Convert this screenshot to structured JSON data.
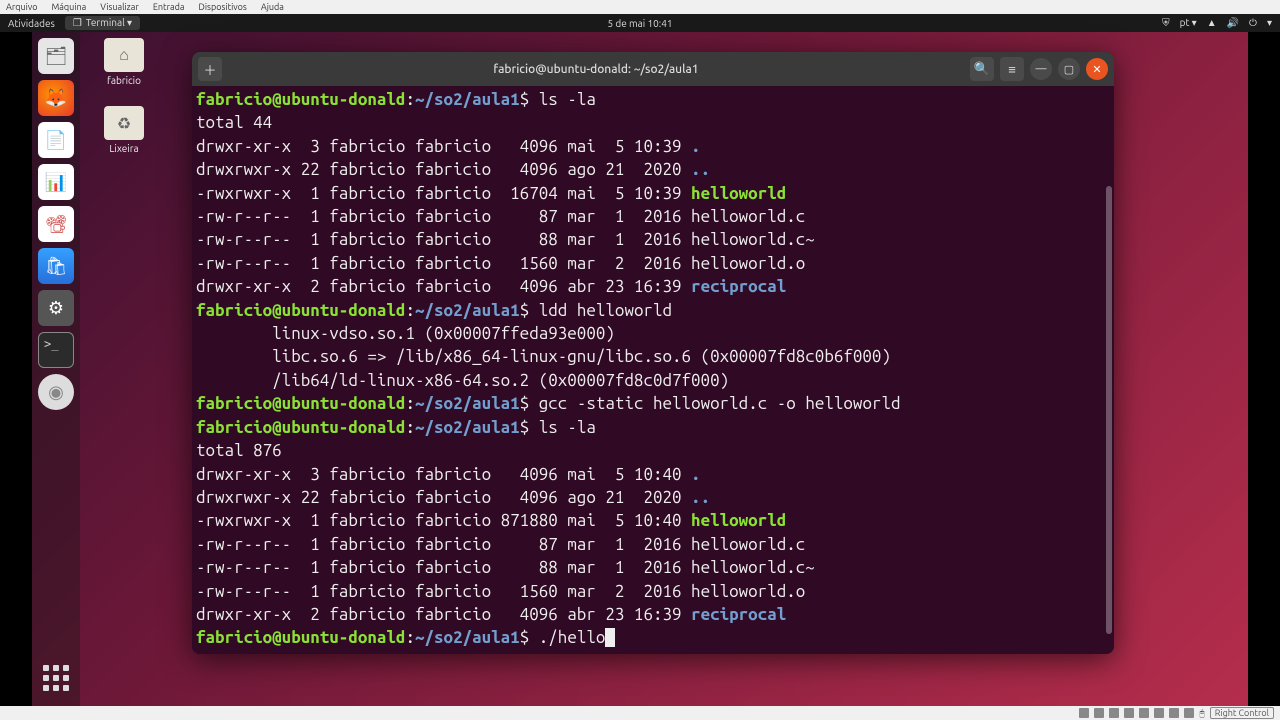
{
  "vbox_menu": [
    "Arquivo",
    "Máquina",
    "Visualizar",
    "Entrada",
    "Dispositivos",
    "Ajuda"
  ],
  "topbar": {
    "activities": "Atividades",
    "app": "Terminal ▾",
    "clock": "5 de mai  10:41",
    "lang": "pt ▾"
  },
  "desktop_icons": {
    "home": "fabricio",
    "trash": "Lixeira"
  },
  "terminal": {
    "title": "fabricio@ubuntu-donald: ~/so2/aula1",
    "prompt_user": "fabricio@ubuntu-donald",
    "prompt_path": "~/so2/aula1",
    "cmds": {
      "ls1": "ls -la",
      "ldd": "ldd helloworld",
      "gcc": "gcc -static helloworld.c -o helloworld",
      "ls2": "ls -la",
      "run": "./hello"
    },
    "total1": "total 44",
    "total2": "total 876",
    "listing1": [
      {
        "perm": "drwxr-xr-x",
        "links": " 3",
        "owner": "fabricio",
        "group": "fabricio",
        "size": "  4096",
        "date": "mai  5 10:39",
        "name": ".",
        "type": "dir"
      },
      {
        "perm": "drwxrwxr-x",
        "links": "22",
        "owner": "fabricio",
        "group": "fabricio",
        "size": "  4096",
        "date": "ago 21  2020",
        "name": "..",
        "type": "dir"
      },
      {
        "perm": "-rwxrwxr-x",
        "links": " 1",
        "owner": "fabricio",
        "group": "fabricio",
        "size": " 16704",
        "date": "mai  5 10:39",
        "name": "helloworld",
        "type": "exec"
      },
      {
        "perm": "-rw-r--r--",
        "links": " 1",
        "owner": "fabricio",
        "group": "fabricio",
        "size": "    87",
        "date": "mar  1  2016",
        "name": "helloworld.c",
        "type": "file"
      },
      {
        "perm": "-rw-r--r--",
        "links": " 1",
        "owner": "fabricio",
        "group": "fabricio",
        "size": "    88",
        "date": "mar  1  2016",
        "name": "helloworld.c~",
        "type": "file"
      },
      {
        "perm": "-rw-r--r--",
        "links": " 1",
        "owner": "fabricio",
        "group": "fabricio",
        "size": "  1560",
        "date": "mar  2  2016",
        "name": "helloworld.o",
        "type": "file"
      },
      {
        "perm": "drwxr-xr-x",
        "links": " 2",
        "owner": "fabricio",
        "group": "fabricio",
        "size": "  4096",
        "date": "abr 23 16:39",
        "name": "reciprocal",
        "type": "dir"
      }
    ],
    "ldd_out": [
      "        linux-vdso.so.1 (0x00007ffeda93e000)",
      "        libc.so.6 => /lib/x86_64-linux-gnu/libc.so.6 (0x00007fd8c0b6f000)",
      "        /lib64/ld-linux-x86-64.so.2 (0x00007fd8c0d7f000)"
    ],
    "listing2": [
      {
        "perm": "drwxr-xr-x",
        "links": " 3",
        "owner": "fabricio",
        "group": "fabricio",
        "size": "  4096",
        "date": "mai  5 10:40",
        "name": ".",
        "type": "dir"
      },
      {
        "perm": "drwxrwxr-x",
        "links": "22",
        "owner": "fabricio",
        "group": "fabricio",
        "size": "  4096",
        "date": "ago 21  2020",
        "name": "..",
        "type": "dir"
      },
      {
        "perm": "-rwxrwxr-x",
        "links": " 1",
        "owner": "fabricio",
        "group": "fabricio",
        "size": "871880",
        "date": "mai  5 10:40",
        "name": "helloworld",
        "type": "exec"
      },
      {
        "perm": "-rw-r--r--",
        "links": " 1",
        "owner": "fabricio",
        "group": "fabricio",
        "size": "    87",
        "date": "mar  1  2016",
        "name": "helloworld.c",
        "type": "file"
      },
      {
        "perm": "-rw-r--r--",
        "links": " 1",
        "owner": "fabricio",
        "group": "fabricio",
        "size": "    88",
        "date": "mar  1  2016",
        "name": "helloworld.c~",
        "type": "file"
      },
      {
        "perm": "-rw-r--r--",
        "links": " 1",
        "owner": "fabricio",
        "group": "fabricio",
        "size": "  1560",
        "date": "mar  2  2016",
        "name": "helloworld.o",
        "type": "file"
      },
      {
        "perm": "drwxr-xr-x",
        "links": " 2",
        "owner": "fabricio",
        "group": "fabricio",
        "size": "  4096",
        "date": "abr 23 16:39",
        "name": "reciprocal",
        "type": "dir"
      }
    ]
  },
  "vbox_status": {
    "hostkey": "Right Control"
  }
}
